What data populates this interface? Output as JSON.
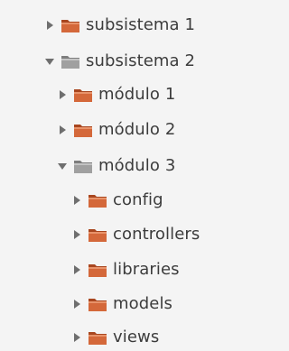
{
  "tree": {
    "items": [
      {
        "label": "subsistema 1",
        "expanded": false,
        "folder_icon": "folder-orange-icon"
      },
      {
        "label": "subsistema 2",
        "expanded": true,
        "folder_icon": "folder-gray-icon"
      },
      {
        "label": "módulo 1",
        "expanded": false,
        "folder_icon": "folder-orange-icon"
      },
      {
        "label": "módulo 2",
        "expanded": false,
        "folder_icon": "folder-orange-icon"
      },
      {
        "label": "módulo 3",
        "expanded": true,
        "folder_icon": "folder-gray-icon"
      },
      {
        "label": "config",
        "expanded": false,
        "folder_icon": "folder-orange-icon"
      },
      {
        "label": "controllers",
        "expanded": false,
        "folder_icon": "folder-orange-icon"
      },
      {
        "label": "libraries",
        "expanded": false,
        "folder_icon": "folder-orange-icon"
      },
      {
        "label": "models",
        "expanded": false,
        "folder_icon": "folder-orange-icon"
      },
      {
        "label": "views",
        "expanded": false,
        "folder_icon": "folder-orange-icon"
      }
    ]
  },
  "colors": {
    "background": "#f4f4f4",
    "text": "#3c3c3c",
    "arrow": "#6e6e6e",
    "folder_orange": "#d4683a",
    "folder_gray": "#9a9a9a"
  }
}
